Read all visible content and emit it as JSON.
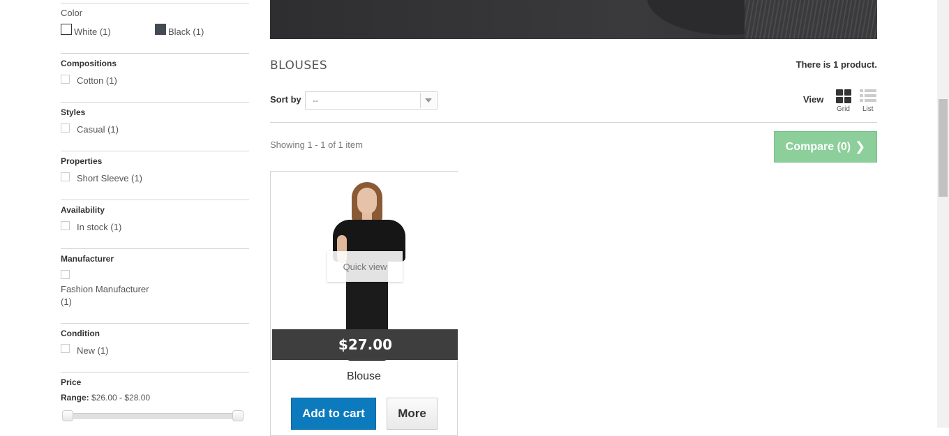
{
  "sidebar": {
    "color": {
      "title": "Color",
      "options": [
        {
          "label": "White (1)",
          "swatch": "#ffffff"
        },
        {
          "label": "Black (1)",
          "swatch": "#434a54"
        }
      ]
    },
    "compositions": {
      "title": "Compositions",
      "options": [
        {
          "label": "Cotton (1)"
        }
      ]
    },
    "styles": {
      "title": "Styles",
      "options": [
        {
          "label": "Casual (1)"
        }
      ]
    },
    "properties": {
      "title": "Properties",
      "options": [
        {
          "label": "Short Sleeve (1)"
        }
      ]
    },
    "availability": {
      "title": "Availability",
      "options": [
        {
          "label": "In stock (1)"
        }
      ]
    },
    "manufacturer": {
      "title": "Manufacturer",
      "options": [
        {
          "label_line1": "Fashion Manufacturer",
          "label_line2": "(1)"
        }
      ]
    },
    "condition": {
      "title": "Condition",
      "options": [
        {
          "label": "New (1)"
        }
      ]
    },
    "price": {
      "title": "Price",
      "range_label": "Range:",
      "range_value": "$26.00 - $28.00",
      "min": 26.0,
      "max": 28.0
    }
  },
  "category": {
    "title": "BLOUSES",
    "count_text": "There is 1 product."
  },
  "toolbar": {
    "sort_label": "Sort by",
    "sort_value": "--",
    "view_label": "View",
    "grid_label": "Grid",
    "list_label": "List",
    "showing": "Showing 1 - 1 of 1 item",
    "compare_label": "Compare (0)"
  },
  "product": {
    "name": "Blouse",
    "price": "$27.00",
    "quick_view": "Quick view",
    "add_to_cart": "Add to cart",
    "more": "More"
  },
  "colors": {
    "accent_blue": "#0c7bbd",
    "compare_green": "#8ccf9b",
    "price_bar": "#3e3e3e"
  },
  "icons": {
    "grid": "grid-view-icon",
    "list": "list-view-icon",
    "compare": "chevron-right-icon",
    "sort": "chevron-down-icon"
  }
}
